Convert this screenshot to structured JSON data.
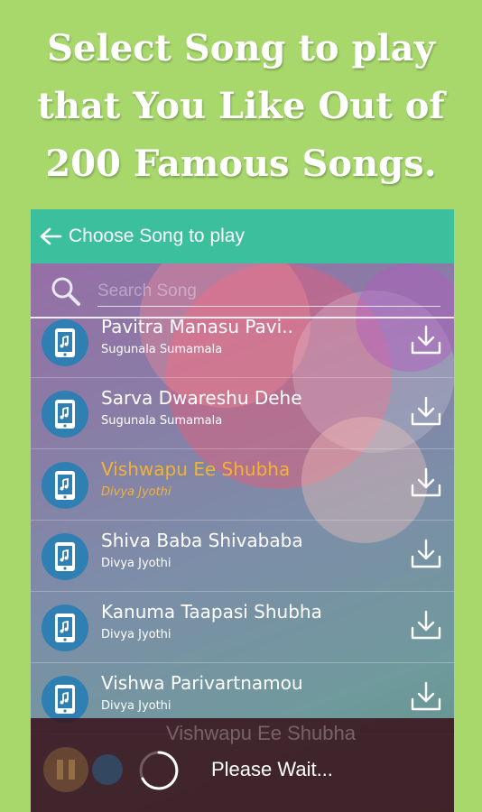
{
  "promo": {
    "line1": "Select Song to play",
    "line2": "that You Like Out of",
    "line3": "200 Famous Songs."
  },
  "appbar": {
    "back_icon": "arrow-left-icon",
    "title": "Choose Song to play",
    "color": "#3bbf9c"
  },
  "search": {
    "icon": "search-icon",
    "placeholder": "Search Song",
    "value": ""
  },
  "songs": [
    {
      "title": "Pavitra Manasu Pavi..",
      "artist": "Sugunala Sumamala",
      "active": false
    },
    {
      "title": "Sarva Dwareshu Dehe",
      "artist": "Sugunala Sumamala",
      "active": false
    },
    {
      "title": "Vishwapu Ee Shubha",
      "artist": "Divya Jyothi",
      "active": true
    },
    {
      "title": "Shiva Baba Shivababa",
      "artist": "Divya Jyothi",
      "active": false
    },
    {
      "title": "Kanuma Taapasi Shubha",
      "artist": "Divya Jyothi",
      "active": false
    },
    {
      "title": "Vishwa Parivartnamou",
      "artist": "Divya Jyothi",
      "active": false
    }
  ],
  "player": {
    "now_playing": "Vishwapu Ee Shubha",
    "status": "Please Wait..."
  },
  "colors": {
    "background": "#a8d86c",
    "active_song": "#f2b233",
    "song_icon_bg": "#2f7fb3"
  }
}
